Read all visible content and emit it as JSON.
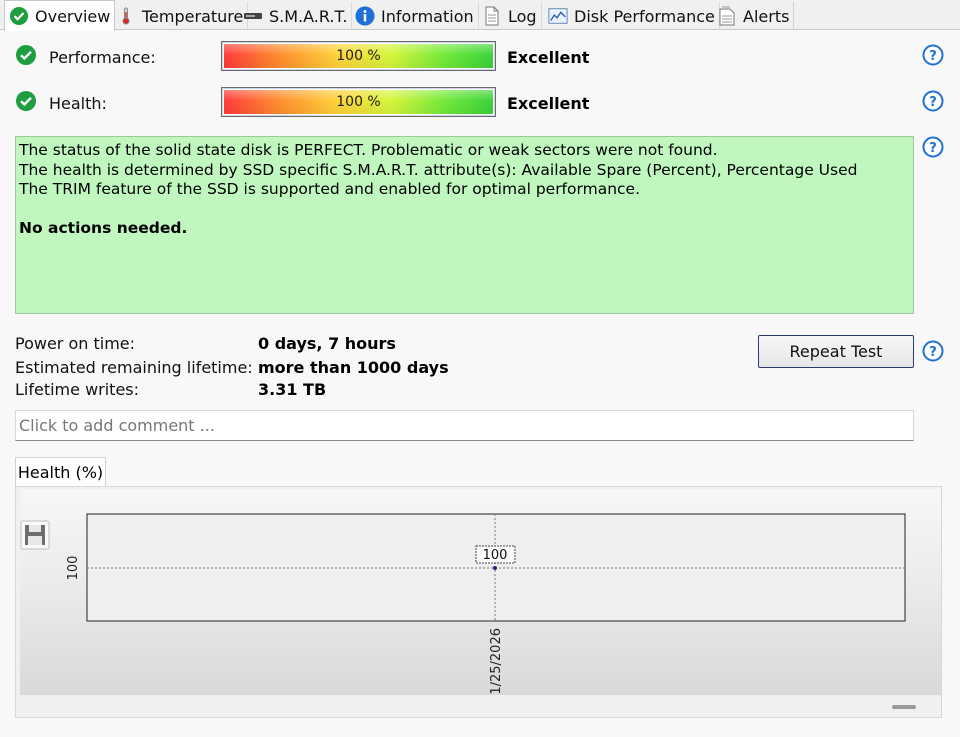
{
  "tabs": [
    {
      "label": "Overview",
      "icon": "check-circle-icon",
      "active": true
    },
    {
      "label": "Temperature",
      "icon": "thermometer-icon",
      "active": false
    },
    {
      "label": "S.M.A.R.T.",
      "icon": "drive-icon",
      "active": false
    },
    {
      "label": "Information",
      "icon": "info-icon",
      "active": false
    },
    {
      "label": "Log",
      "icon": "document-icon",
      "active": false
    },
    {
      "label": "Disk Performance",
      "icon": "chart-icon",
      "active": false
    },
    {
      "label": "Alerts",
      "icon": "alerts-document-icon",
      "active": false
    }
  ],
  "performance": {
    "label": "Performance:",
    "value_text": "100 %",
    "value": 100,
    "rating": "Excellent"
  },
  "health": {
    "label": "Health:",
    "value_text": "100 %",
    "value": 100,
    "rating": "Excellent"
  },
  "status": {
    "lines": [
      "The status of the solid state disk is PERFECT. Problematic or weak sectors were not found.",
      "The health is determined by SSD specific S.M.A.R.T. attribute(s):  Available Spare (Percent), Percentage Used",
      "The TRIM feature of the SSD is supported and enabled for optimal performance."
    ],
    "action": "No actions needed."
  },
  "info": {
    "power_on_label": "Power on time:",
    "power_on_value": "0 days, 7 hours",
    "lifetime_label": "Estimated remaining lifetime:",
    "lifetime_value": "more than 1000 days",
    "writes_label": "Lifetime writes:",
    "writes_value": "3.31 TB"
  },
  "repeat_button": "Repeat Test",
  "comment_placeholder": "Click to add comment ...",
  "chart_tab": "Health (%)",
  "colors": {
    "status_bg": "#bff7bf",
    "help_blue": "#1e6fd6",
    "check_green": "#1e9e3e"
  },
  "chart_data": {
    "type": "line",
    "x": [
      "1/25/2026"
    ],
    "series": [
      {
        "values": [
          100
        ]
      }
    ],
    "point_label": "100",
    "ytick": "100",
    "xtick": "1/25/2026",
    "grid": true
  }
}
